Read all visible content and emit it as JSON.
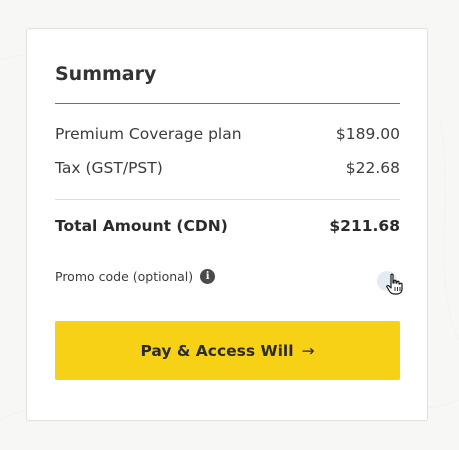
{
  "summary": {
    "title": "Summary",
    "items": [
      {
        "label": "Premium Coverage plan",
        "amount": "$189.00"
      },
      {
        "label": "Tax (GST/PST)",
        "amount": "$22.68"
      }
    ],
    "total": {
      "label": "Total Amount (CDN)",
      "amount": "$211.68"
    },
    "promo": {
      "label": "Promo code (optional)",
      "info_icon": "info-icon",
      "toggle_icon": "chevron-down-icon"
    },
    "pay_button": {
      "label": "Pay & Access Will",
      "arrow": "→"
    }
  },
  "colors": {
    "accent_yellow": "#f7d116",
    "text_dark": "#2b2b2b",
    "background": "#f7f7f6"
  }
}
